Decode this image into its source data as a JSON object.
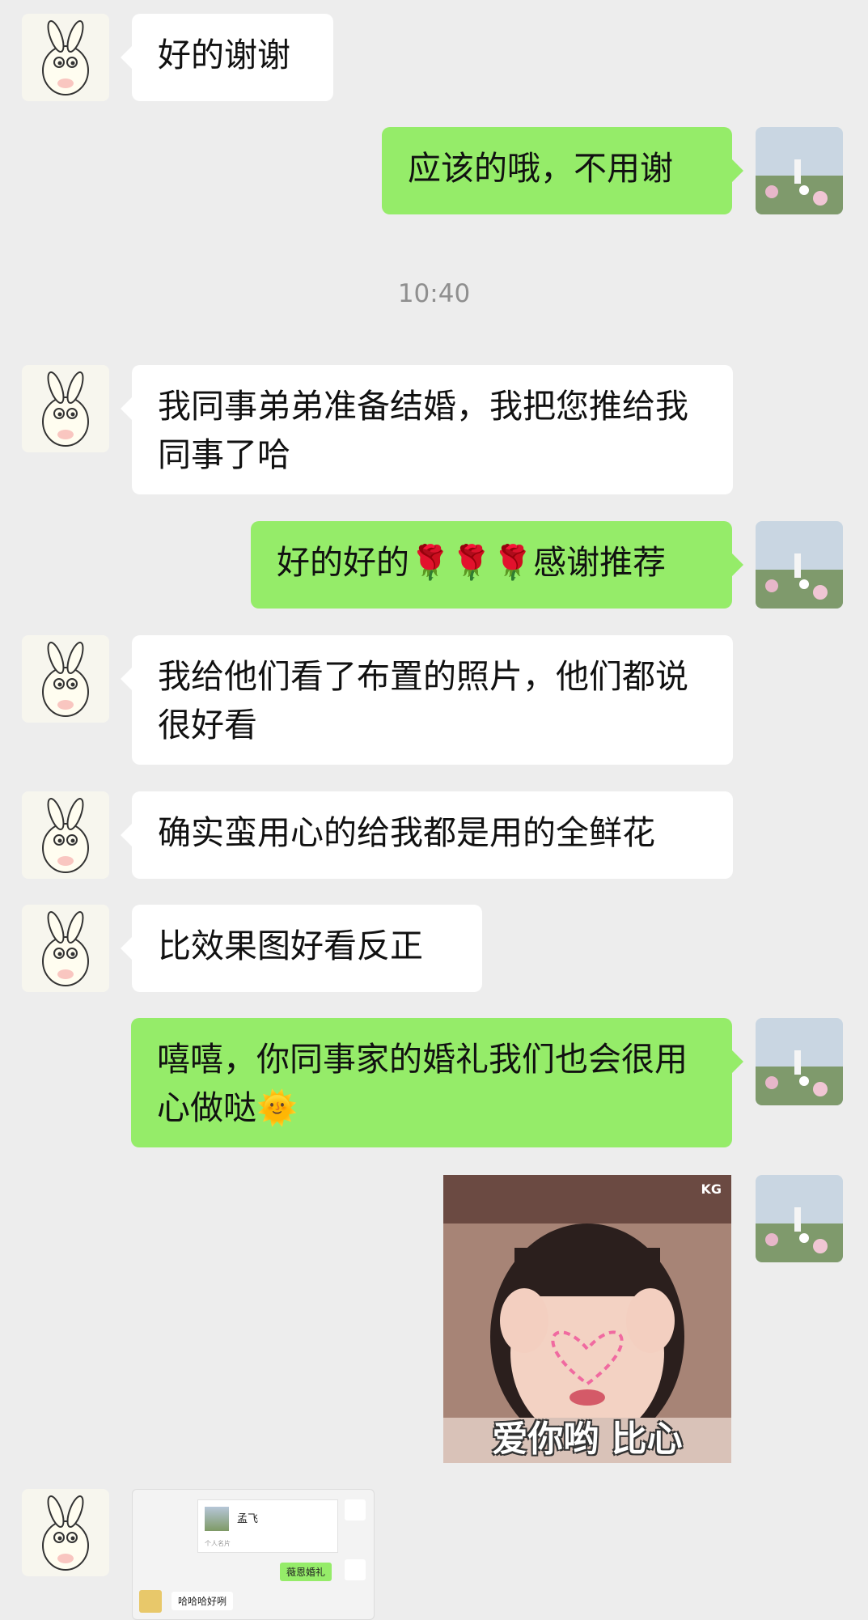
{
  "timestamp": "10:40",
  "messages": [
    {
      "side": "left",
      "text": "好的谢谢"
    },
    {
      "side": "right",
      "text": "应该的哦，不用谢"
    },
    {
      "side": "left",
      "text": "我同事弟弟准备结婚，我把您推给我同事了哈"
    },
    {
      "side": "right",
      "text": "好的好的🌹🌹🌹感谢推荐"
    },
    {
      "side": "left",
      "text": "我给他们看了布置的照片，他们都说很好看"
    },
    {
      "side": "left",
      "text": "确实蛮用心的给我都是用的全鲜花"
    },
    {
      "side": "left",
      "text": "比效果图好看反正"
    },
    {
      "side": "right",
      "text": "嘻嘻，你同事家的婚礼我们也会很用心做哒🌞"
    }
  ],
  "sticker": {
    "caption": "爱你哟 比心",
    "watermark": "KG"
  },
  "screenshot_preview": {
    "card_name": "孟飞",
    "card_type": "个人名片",
    "right_msg": "薇恩婚礼",
    "left_msg": "哈哈哈好咧"
  },
  "colors": {
    "background": "#ededed",
    "sent_bubble": "#95ec69",
    "received_bubble": "#ffffff"
  }
}
